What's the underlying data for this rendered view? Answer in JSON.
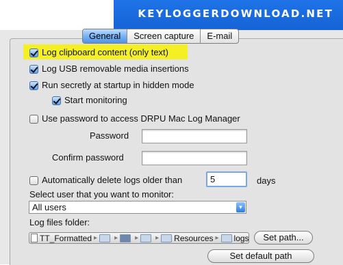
{
  "banner": {
    "text": "KEYLOGGERDOWNLOAD.NET"
  },
  "tabs": [
    {
      "label": "General",
      "active": true
    },
    {
      "label": "Screen capture",
      "active": false
    },
    {
      "label": "E-mail",
      "active": false
    }
  ],
  "options": {
    "log_clipboard": {
      "label": "Log clipboard content (only text)",
      "checked": true
    },
    "log_usb": {
      "label": "Log USB removable media insertions",
      "checked": true
    },
    "run_secretly": {
      "label": "Run secretly at startup in hidden mode",
      "checked": true
    },
    "start_monitoring": {
      "label": "Start monitoring",
      "checked": true
    },
    "use_password": {
      "label": "Use password to access DRPU Mac Log Manager",
      "checked": false
    },
    "auto_delete": {
      "label": "Automatically delete logs older than",
      "checked": false
    }
  },
  "password": {
    "label": "Password",
    "value": ""
  },
  "confirm_password": {
    "label": "Confirm password",
    "value": ""
  },
  "auto_delete_days": {
    "value": "5",
    "unit": "days"
  },
  "select_user": {
    "label": "Select user that you want to monitor:",
    "value": "All users"
  },
  "log_folder": {
    "label": "Log files folder:",
    "path_segments": [
      "TT_Formatted",
      "",
      "",
      "",
      "Resources",
      "logs"
    ]
  },
  "buttons": {
    "set_path": "Set path...",
    "set_default_path": "Set default path"
  },
  "colors": {
    "banner_blue": "#1e73e6",
    "highlight_yellow": "#f5f025",
    "tab_active_blue": "#72aef3"
  }
}
